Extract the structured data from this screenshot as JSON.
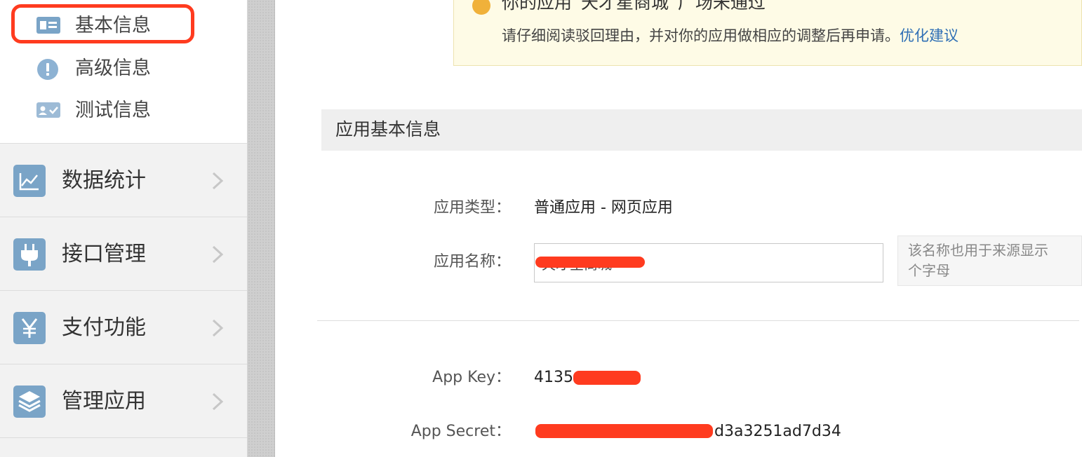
{
  "sidebar": {
    "sub_items": [
      {
        "label": "基本信息",
        "icon": "id-card-icon"
      },
      {
        "label": "高级信息",
        "icon": "info-circle-icon"
      },
      {
        "label": "测试信息",
        "icon": "test-card-icon"
      }
    ],
    "nav_items": [
      {
        "label": "数据统计",
        "icon": "line-chart-icon"
      },
      {
        "label": "接口管理",
        "icon": "plug-icon"
      },
      {
        "label": "支付功能",
        "icon": "yen-icon"
      },
      {
        "label": "管理应用",
        "icon": "layers-icon"
      }
    ]
  },
  "notice": {
    "title": "你的应用“天才星商城”广场未通过",
    "message": "请仔细阅读驳回理由，并对你的应用做相应的调整后再申请。",
    "link": "优化建议"
  },
  "section": {
    "title": "应用基本信息"
  },
  "fields": {
    "type_label": "应用类型：",
    "type_value": "普通应用  -  网页应用",
    "name_label": "应用名称：",
    "name_value": "天才星商城",
    "name_hint": "该名称也用于来源显示\n个字母",
    "appkey_label": "App Key：",
    "appkey_value": "4135",
    "secret_label": "App Secret：",
    "secret_value": "d3a3251ad7d34"
  },
  "colors": {
    "accent": "#7aa4c7",
    "annotation_red": "#ff3b1f",
    "link": "#2f6fb5",
    "notice_bg": "#fefbe6"
  }
}
